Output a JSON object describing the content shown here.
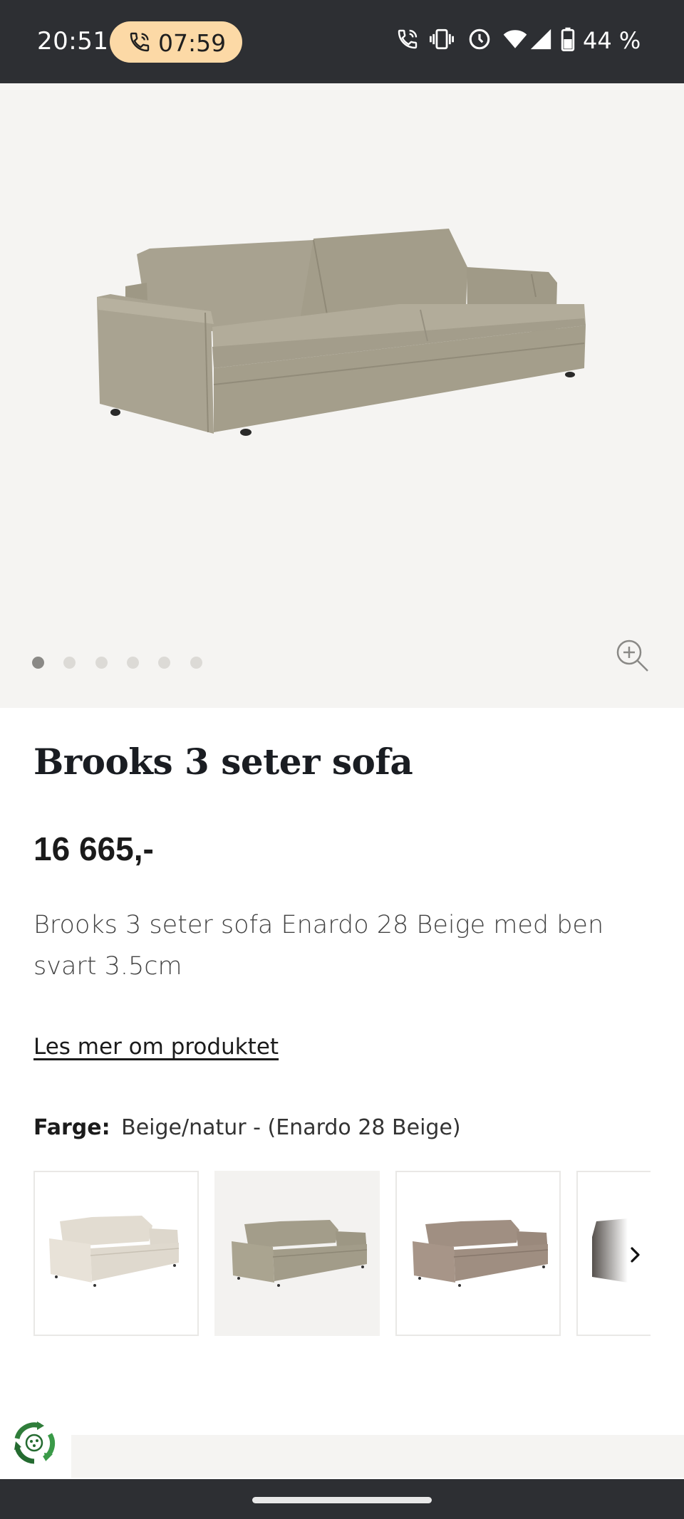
{
  "status_bar": {
    "time": "20:51",
    "call_timer": "07:59",
    "battery": "44 %",
    "icons": [
      "wifi-calling-icon",
      "vibrate-icon",
      "alarm-icon",
      "wifi-icon",
      "signal-icon",
      "battery-icon"
    ]
  },
  "gallery": {
    "image_count": 6,
    "active_index": 0,
    "zoom_icon": "zoom-in-icon"
  },
  "product": {
    "title": "Brooks 3 seter sofa",
    "price": "16 665,-",
    "description": "Brooks 3 seter sofa Enardo 28 Beige med ben svart 3.5cm",
    "read_more": "Les mer om produktet",
    "color_label": "Farge:",
    "color_value": "Beige/natur - (Enardo 28 Beige)"
  },
  "swatches": [
    {
      "color": "#e6e0d6",
      "selected": false
    },
    {
      "color": "#aaa38f",
      "selected": true
    },
    {
      "color": "#a8978a",
      "selected": false
    },
    {
      "color": "#5f5a56",
      "selected": false
    }
  ],
  "colors": {
    "status_bar_bg": "#2d2f33",
    "call_pill": "#fcd9a6",
    "hero_bg": "#f5f4f2",
    "sofa": "#a9a391",
    "title_text": "#1a1d22"
  }
}
